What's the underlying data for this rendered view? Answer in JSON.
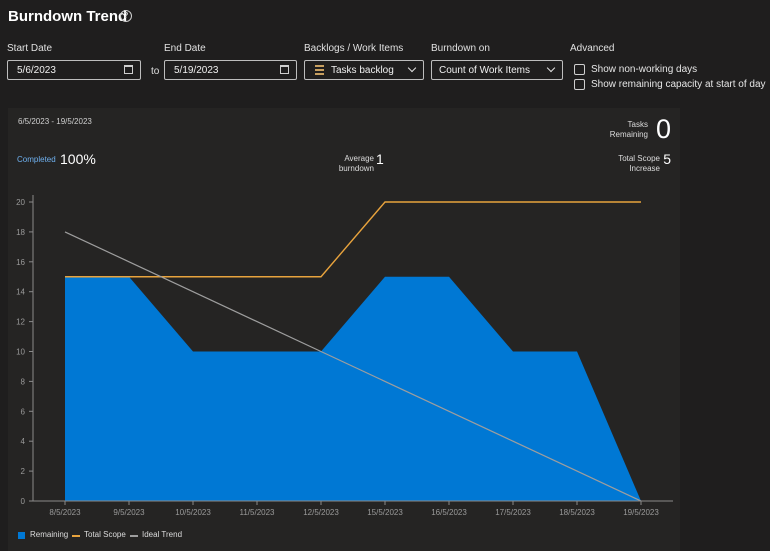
{
  "header": {
    "title": "Burndown Trend",
    "help_icon": "help-circle-icon"
  },
  "filters": {
    "start_date_label": "Start Date",
    "start_date_value": "5/6/2023",
    "to_label": "to",
    "end_date_label": "End Date",
    "end_date_value": "5/19/2023",
    "backlogs_label": "Backlogs / Work Items",
    "backlogs_value": "Tasks backlog",
    "burndown_on_label": "Burndown on",
    "burndown_on_value": "Count of Work Items",
    "advanced_label": "Advanced",
    "show_non_working_days": "Show non-working days",
    "show_remaining_capacity": "Show remaining capacity at start of day"
  },
  "summary": {
    "date_range": "6/5/2023 - 19/5/2023",
    "tasks_remaining_label_1": "Tasks",
    "tasks_remaining_label_2": "Remaining",
    "tasks_remaining_value": "0",
    "completed_label": "Completed",
    "completed_value": "100%",
    "avg_burndown_label_1": "Average",
    "avg_burndown_label_2": "burndown",
    "avg_burndown_value": "1",
    "scope_increase_label_1": "Total Scope",
    "scope_increase_label_2": "Increase",
    "scope_increase_value": "5"
  },
  "colors": {
    "remaining": "#0078d4",
    "total_scope": "#e8a33d",
    "ideal_trend": "#9e9e9e"
  },
  "chart_data": {
    "type": "area",
    "categories": [
      "8/5/2023",
      "9/5/2023",
      "10/5/2023",
      "11/5/2023",
      "12/5/2023",
      "15/5/2023",
      "16/5/2023",
      "17/5/2023",
      "18/5/2023",
      "19/5/2023"
    ],
    "ylim": [
      0,
      20
    ],
    "yticks": [
      "0",
      "2",
      "4",
      "6",
      "8",
      "10",
      "12",
      "14",
      "16",
      "18",
      "20"
    ],
    "series": [
      {
        "name": "Remaining",
        "type": "area",
        "values": [
          15,
          15,
          10,
          10,
          10,
          15,
          15,
          10,
          10,
          0
        ]
      },
      {
        "name": "Total Scope",
        "type": "line",
        "values": [
          15,
          15,
          15,
          15,
          15,
          20,
          20,
          20,
          20,
          20
        ]
      },
      {
        "name": "Ideal Trend",
        "type": "line",
        "values": [
          18,
          16,
          14,
          12,
          10,
          8,
          6,
          4,
          2,
          0
        ]
      }
    ],
    "legend": "bottom-left",
    "grid": false
  }
}
